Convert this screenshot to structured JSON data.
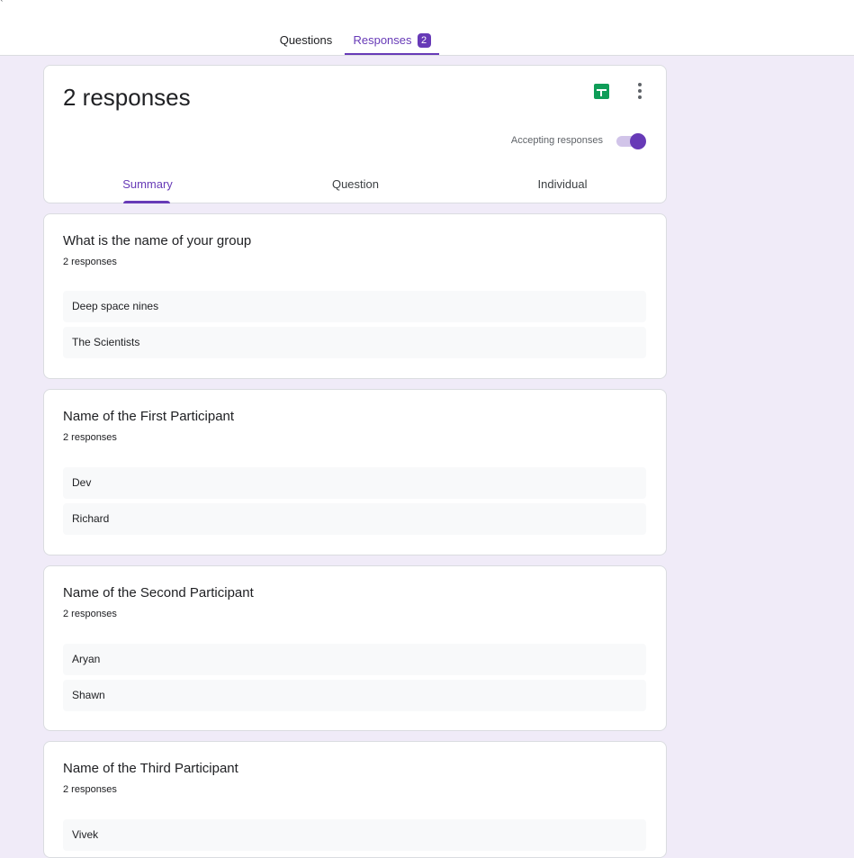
{
  "topbar": {
    "corner_mark": "‹",
    "tabs": [
      {
        "label": "Questions"
      },
      {
        "label": "Responses",
        "badge": "2"
      }
    ]
  },
  "header": {
    "title": "2 responses",
    "accepting_label": "Accepting responses",
    "accepting_on": true,
    "icons": [
      "sheets-icon",
      "more-vert-icon"
    ],
    "sub_tabs": [
      "Summary",
      "Question",
      "Individual"
    ],
    "active_sub_tab": "Summary"
  },
  "questions": [
    {
      "title": "What is the name of your group",
      "count": "2 responses",
      "answers": [
        "Deep space nines",
        "The Scientists"
      ]
    },
    {
      "title": "Name of the First Participant",
      "count": "2 responses",
      "answers": [
        "Dev",
        "Richard"
      ]
    },
    {
      "title": "Name of the Second Participant",
      "count": "2 responses",
      "answers": [
        "Aryan",
        "Shawn"
      ]
    },
    {
      "title": "Name of the Third Participant",
      "count": "2 responses",
      "answers": [
        "Vivek"
      ]
    }
  ],
  "colors": {
    "accent": "#673ab7",
    "background": "#f0ebf8",
    "sheets_green": "#0f9d58"
  }
}
